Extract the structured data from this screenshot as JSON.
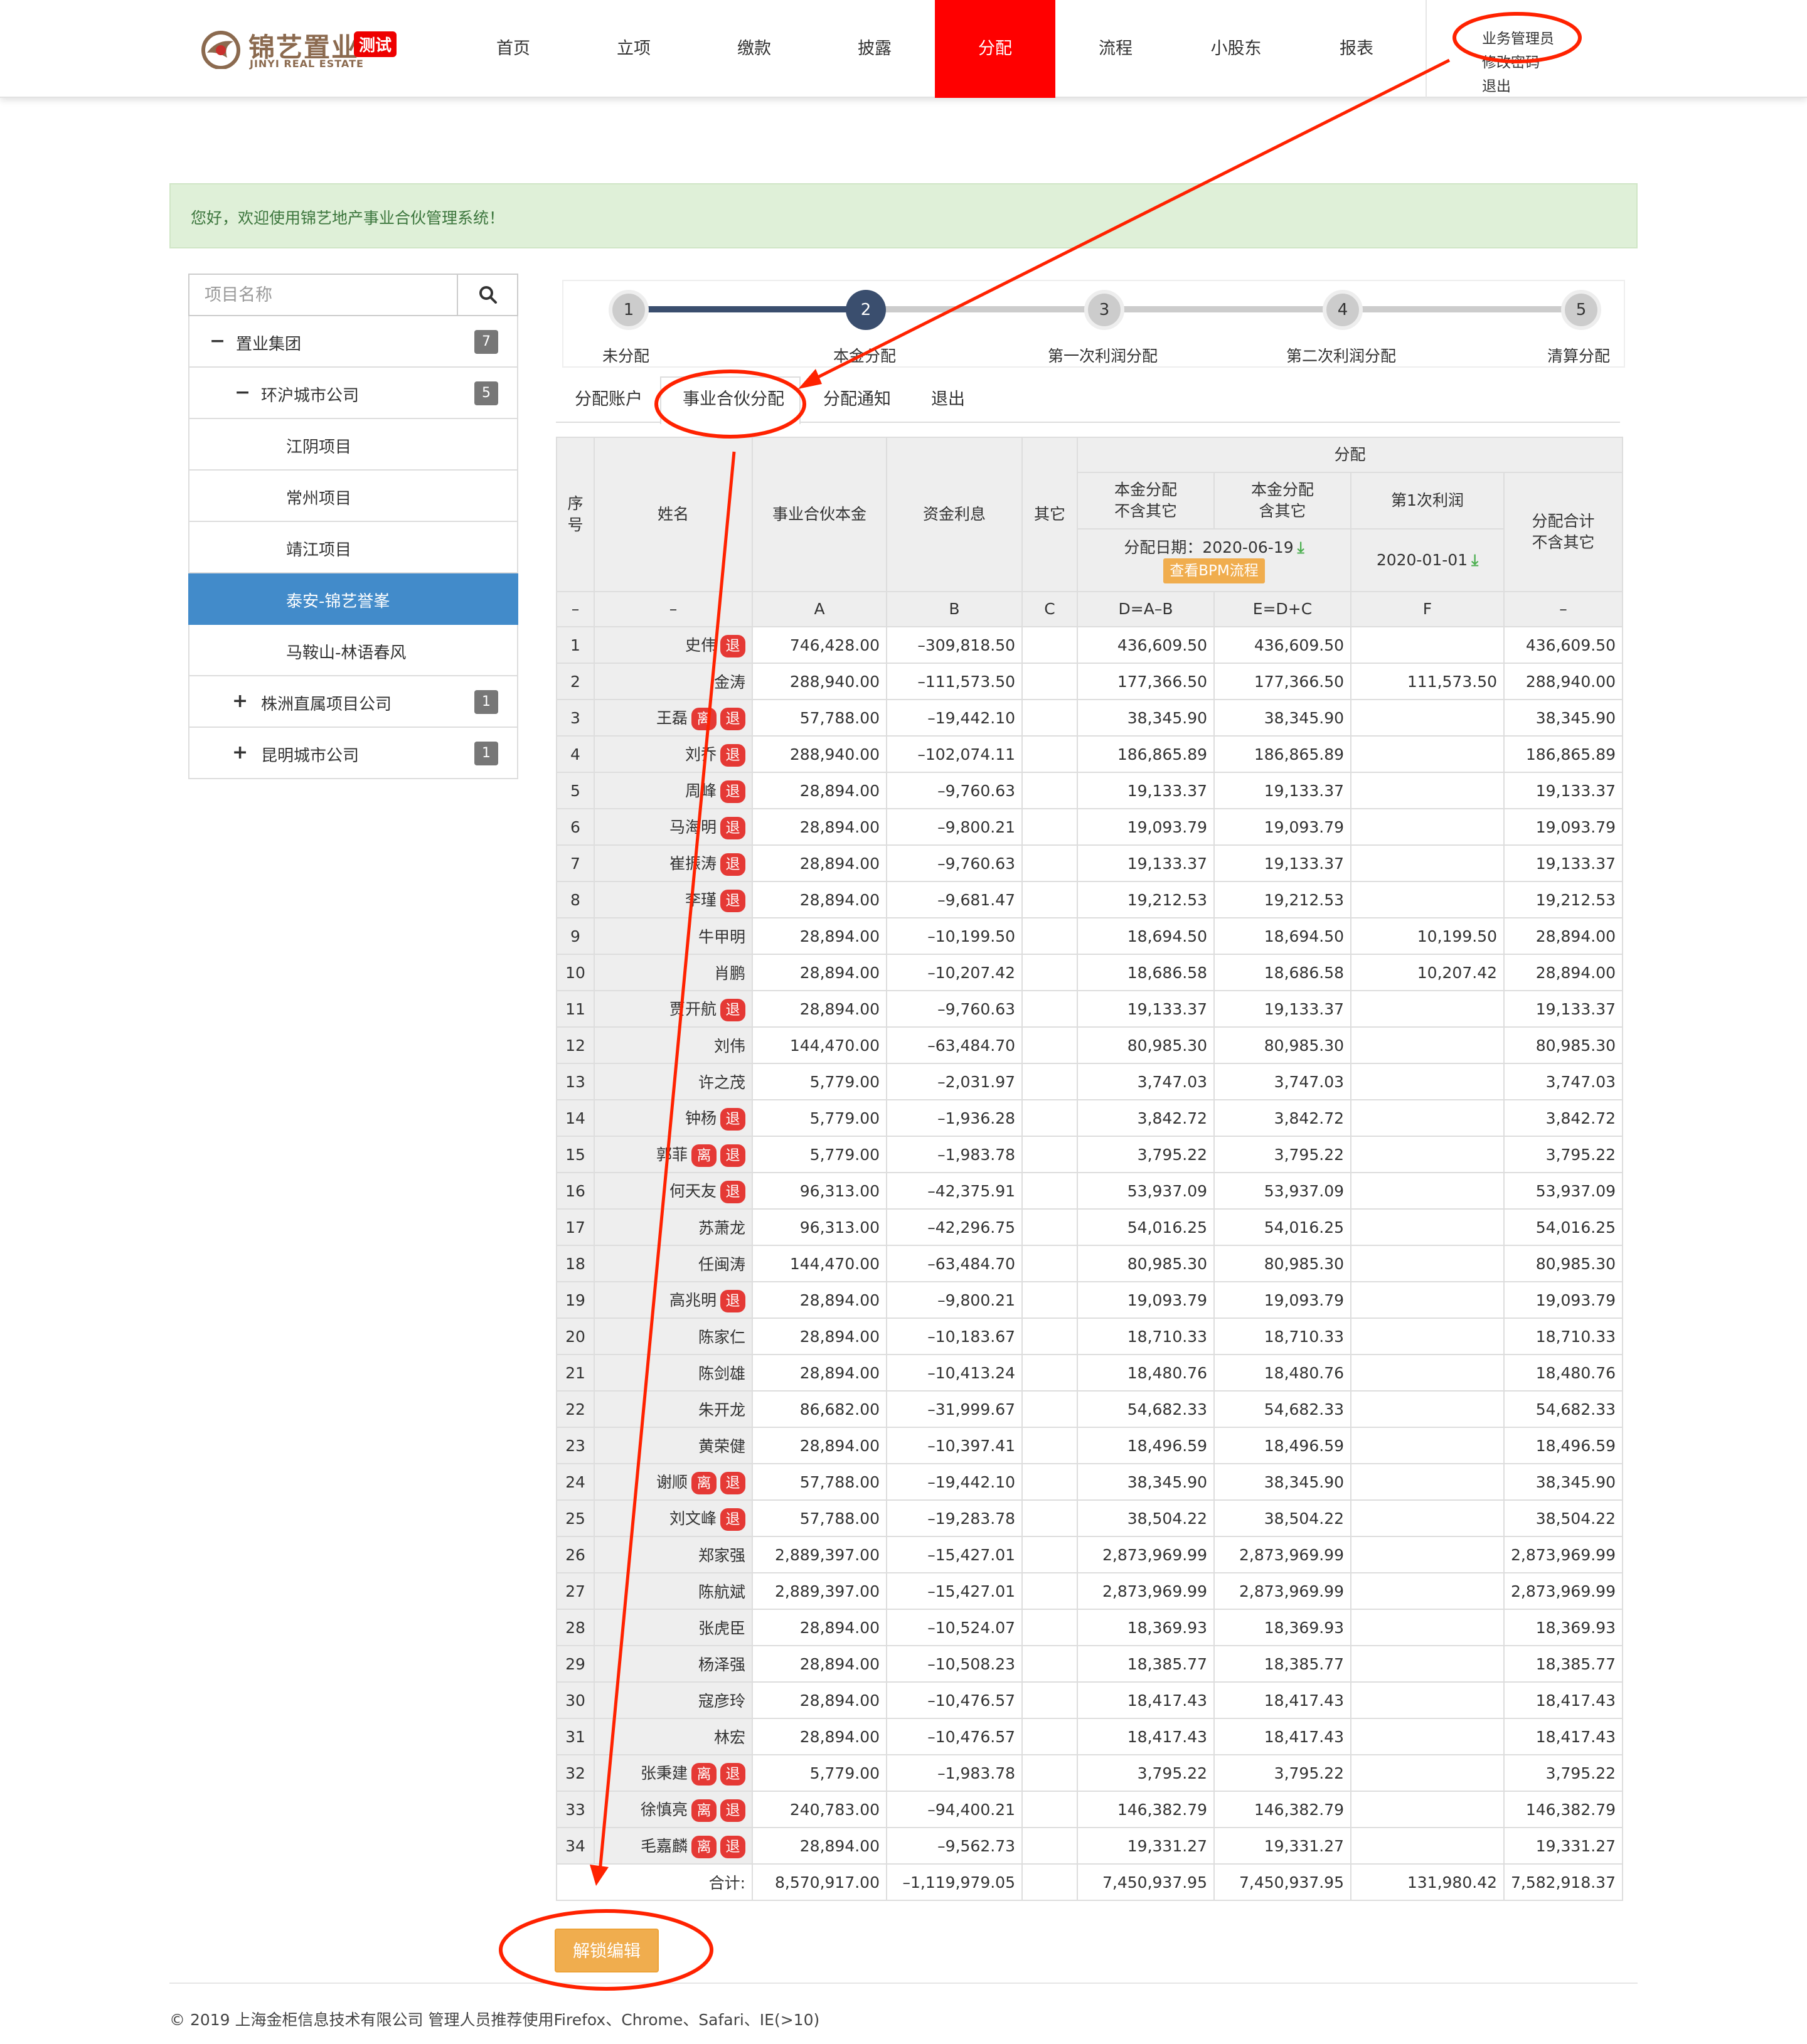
{
  "header": {
    "logo_text": "锦艺置业",
    "logo_badge": "测试",
    "logo_en": "JINYI REAL ESTATE",
    "nav": [
      "首页",
      "立项",
      "缴款",
      "披露",
      "分配",
      "流程",
      "小股东",
      "报表"
    ],
    "active_nav": "分配",
    "user": {
      "role": "业务管理员",
      "change_password": "修改密码",
      "logout": "退出"
    }
  },
  "welcome": "您好，欢迎使用锦艺地产事业合伙管理系统！",
  "sidebar": {
    "search_placeholder": "项目名称",
    "tree": [
      {
        "label": "置业集团",
        "count": "7",
        "toggle": "−",
        "level": 0
      },
      {
        "label": "环沪城市公司",
        "count": "5",
        "toggle": "−",
        "level": 1
      },
      {
        "label": "江阴项目",
        "level": 2
      },
      {
        "label": "常州项目",
        "level": 2
      },
      {
        "label": "靖江项目",
        "level": 2
      },
      {
        "label": "泰安-锦艺誉峯",
        "level": 2,
        "active": true
      },
      {
        "label": "马鞍山-林语春风",
        "level": 2
      },
      {
        "label": "株洲直属项目公司",
        "count": "1",
        "toggle": "+",
        "level": 1
      },
      {
        "label": "昆明城市公司",
        "count": "1",
        "toggle": "+",
        "level": 1
      }
    ]
  },
  "steps": [
    {
      "num": "1",
      "label": "未分配"
    },
    {
      "num": "2",
      "label": "本金分配"
    },
    {
      "num": "3",
      "label": "第一次利润分配"
    },
    {
      "num": "4",
      "label": "第二次利润分配"
    },
    {
      "num": "5",
      "label": "清算分配"
    }
  ],
  "tabs": [
    "分配账户",
    "事业合伙分配",
    "分配通知",
    "退出"
  ],
  "table": {
    "h_index": "序号",
    "h_name": "姓名",
    "h_capital": "事业合伙本金",
    "h_interest": "资金利息",
    "h_other": "其它",
    "h_dist": "分配",
    "h_principal_excl_1": "本金分配",
    "h_principal_excl_2": "不含其它",
    "h_principal_incl_1": "本金分配",
    "h_principal_incl_2": "含其它",
    "h_profit1": "第1次利润",
    "h_total_1": "分配合计",
    "h_total_2": "不含其它",
    "dist_date": "分配日期：2020-06-19",
    "bpm_button": "查看BPM流程",
    "profit_date": "2020-01-01",
    "formula": [
      "–",
      "–",
      "A",
      "B",
      "C",
      "D=A–B",
      "E=D+C",
      "F",
      "–"
    ],
    "tag_leave": "离",
    "tag_exit": "退",
    "rows": [
      [
        "1",
        "史伟",
        "",
        "退",
        "746,428.00",
        "–309,818.50",
        "",
        "436,609.50",
        "436,609.50",
        "",
        "436,609.50"
      ],
      [
        "2",
        "金涛",
        "",
        "",
        "288,940.00",
        "–111,573.50",
        "",
        "177,366.50",
        "177,366.50",
        "111,573.50",
        "288,940.00"
      ],
      [
        "3",
        "王磊",
        "离",
        "退",
        "57,788.00",
        "–19,442.10",
        "",
        "38,345.90",
        "38,345.90",
        "",
        "38,345.90"
      ],
      [
        "4",
        "刘乔",
        "",
        "退",
        "288,940.00",
        "–102,074.11",
        "",
        "186,865.89",
        "186,865.89",
        "",
        "186,865.89"
      ],
      [
        "5",
        "周峰",
        "",
        "退",
        "28,894.00",
        "–9,760.63",
        "",
        "19,133.37",
        "19,133.37",
        "",
        "19,133.37"
      ],
      [
        "6",
        "马海明",
        "",
        "退",
        "28,894.00",
        "–9,800.21",
        "",
        "19,093.79",
        "19,093.79",
        "",
        "19,093.79"
      ],
      [
        "7",
        "崔振涛",
        "",
        "退",
        "28,894.00",
        "–9,760.63",
        "",
        "19,133.37",
        "19,133.37",
        "",
        "19,133.37"
      ],
      [
        "8",
        "李瑾",
        "",
        "退",
        "28,894.00",
        "–9,681.47",
        "",
        "19,212.53",
        "19,212.53",
        "",
        "19,212.53"
      ],
      [
        "9",
        "牛甲明",
        "",
        "",
        "28,894.00",
        "–10,199.50",
        "",
        "18,694.50",
        "18,694.50",
        "10,199.50",
        "28,894.00"
      ],
      [
        "10",
        "肖鹏",
        "",
        "",
        "28,894.00",
        "–10,207.42",
        "",
        "18,686.58",
        "18,686.58",
        "10,207.42",
        "28,894.00"
      ],
      [
        "11",
        "贾开航",
        "",
        "退",
        "28,894.00",
        "–9,760.63",
        "",
        "19,133.37",
        "19,133.37",
        "",
        "19,133.37"
      ],
      [
        "12",
        "刘伟",
        "",
        "",
        "144,470.00",
        "–63,484.70",
        "",
        "80,985.30",
        "80,985.30",
        "",
        "80,985.30"
      ],
      [
        "13",
        "许之茂",
        "",
        "",
        "5,779.00",
        "–2,031.97",
        "",
        "3,747.03",
        "3,747.03",
        "",
        "3,747.03"
      ],
      [
        "14",
        "钟杨",
        "",
        "退",
        "5,779.00",
        "–1,936.28",
        "",
        "3,842.72",
        "3,842.72",
        "",
        "3,842.72"
      ],
      [
        "15",
        "郭菲",
        "离",
        "退",
        "5,779.00",
        "–1,983.78",
        "",
        "3,795.22",
        "3,795.22",
        "",
        "3,795.22"
      ],
      [
        "16",
        "何天友",
        "",
        "退",
        "96,313.00",
        "–42,375.91",
        "",
        "53,937.09",
        "53,937.09",
        "",
        "53,937.09"
      ],
      [
        "17",
        "苏萧龙",
        "",
        "",
        "96,313.00",
        "–42,296.75",
        "",
        "54,016.25",
        "54,016.25",
        "",
        "54,016.25"
      ],
      [
        "18",
        "任闽涛",
        "",
        "",
        "144,470.00",
        "–63,484.70",
        "",
        "80,985.30",
        "80,985.30",
        "",
        "80,985.30"
      ],
      [
        "19",
        "高兆明",
        "",
        "退",
        "28,894.00",
        "–9,800.21",
        "",
        "19,093.79",
        "19,093.79",
        "",
        "19,093.79"
      ],
      [
        "20",
        "陈家仁",
        "",
        "",
        "28,894.00",
        "–10,183.67",
        "",
        "18,710.33",
        "18,710.33",
        "",
        "18,710.33"
      ],
      [
        "21",
        "陈剑雄",
        "",
        "",
        "28,894.00",
        "–10,413.24",
        "",
        "18,480.76",
        "18,480.76",
        "",
        "18,480.76"
      ],
      [
        "22",
        "朱开龙",
        "",
        "",
        "86,682.00",
        "–31,999.67",
        "",
        "54,682.33",
        "54,682.33",
        "",
        "54,682.33"
      ],
      [
        "23",
        "黄荣健",
        "",
        "",
        "28,894.00",
        "–10,397.41",
        "",
        "18,496.59",
        "18,496.59",
        "",
        "18,496.59"
      ],
      [
        "24",
        "谢顺",
        "离",
        "退",
        "57,788.00",
        "–19,442.10",
        "",
        "38,345.90",
        "38,345.90",
        "",
        "38,345.90"
      ],
      [
        "25",
        "刘文峰",
        "",
        "退",
        "57,788.00",
        "–19,283.78",
        "",
        "38,504.22",
        "38,504.22",
        "",
        "38,504.22"
      ],
      [
        "26",
        "郑家强",
        "",
        "",
        "2,889,397.00",
        "–15,427.01",
        "",
        "2,873,969.99",
        "2,873,969.99",
        "",
        "2,873,969.99"
      ],
      [
        "27",
        "陈航斌",
        "",
        "",
        "2,889,397.00",
        "–15,427.01",
        "",
        "2,873,969.99",
        "2,873,969.99",
        "",
        "2,873,969.99"
      ],
      [
        "28",
        "张虎臣",
        "",
        "",
        "28,894.00",
        "–10,524.07",
        "",
        "18,369.93",
        "18,369.93",
        "",
        "18,369.93"
      ],
      [
        "29",
        "杨泽强",
        "",
        "",
        "28,894.00",
        "–10,508.23",
        "",
        "18,385.77",
        "18,385.77",
        "",
        "18,385.77"
      ],
      [
        "30",
        "寇彦玲",
        "",
        "",
        "28,894.00",
        "–10,476.57",
        "",
        "18,417.43",
        "18,417.43",
        "",
        "18,417.43"
      ],
      [
        "31",
        "林宏",
        "",
        "",
        "28,894.00",
        "–10,476.57",
        "",
        "18,417.43",
        "18,417.43",
        "",
        "18,417.43"
      ],
      [
        "32",
        "张秉建",
        "离",
        "退",
        "5,779.00",
        "–1,983.78",
        "",
        "3,795.22",
        "3,795.22",
        "",
        "3,795.22"
      ],
      [
        "33",
        "徐慎亮",
        "离",
        "退",
        "240,783.00",
        "–94,400.21",
        "",
        "146,382.79",
        "146,382.79",
        "",
        "146,382.79"
      ],
      [
        "34",
        "毛嘉麟",
        "离",
        "退",
        "28,894.00",
        "–9,562.73",
        "",
        "19,331.27",
        "19,331.27",
        "",
        "19,331.27"
      ]
    ],
    "footer": [
      "合计:",
      "8,570,917.00",
      "–1,119,979.05",
      "",
      "7,450,937.95",
      "7,450,937.95",
      "131,980.42",
      "7,582,918.37"
    ]
  },
  "unlock_button": "解锁编辑",
  "footer": "© 2019 上海金柜信息技术有限公司  管理人员推荐使用Firefox、Chrome、Safari、IE(>10)",
  "colors": {
    "active_nav": "#ff0000",
    "active_tree": "#428bca",
    "step_done": "#3a4e6e",
    "tag": "#e53935",
    "warning_button": "#f0ad4e",
    "annotation": "#ff2200"
  },
  "icons": [
    "search-icon",
    "download-icon",
    "logo-mark-icon"
  ]
}
